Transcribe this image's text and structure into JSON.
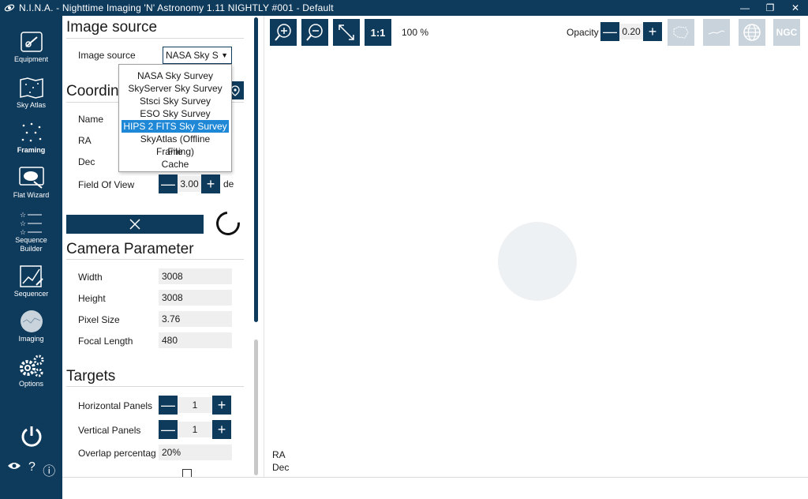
{
  "window": {
    "title": "N.I.N.A. - Nighttime Imaging 'N' Astronomy 1.11 NIGHTLY #001  -  Default",
    "minimize": "—",
    "maximize": "❐",
    "close": "✕"
  },
  "sidebar": {
    "items": [
      {
        "label": "Equipment",
        "icon": "telescope-icon"
      },
      {
        "label": "Sky Atlas",
        "icon": "map-icon"
      },
      {
        "label": "Framing",
        "icon": "stars-icon"
      },
      {
        "label": "Flat Wizard",
        "icon": "flat-wizard-icon"
      },
      {
        "label": "Sequence Builder",
        "icon": "list-stars-icon"
      },
      {
        "label": "Sequencer",
        "icon": "sequencer-icon"
      },
      {
        "label": "Imaging",
        "icon": "imaging-icon"
      },
      {
        "label": "Options",
        "icon": "gears-icon"
      }
    ],
    "active": "Framing",
    "bottom": {
      "power": "⏻",
      "eye": "👁",
      "help": "?",
      "info": "ⓘ"
    }
  },
  "image_source": {
    "title": "Image source",
    "label": "Image source",
    "selected": "NASA Sky S",
    "options": [
      "NASA Sky Survey",
      "SkyServer Sky Survey",
      "Stsci Sky Survey",
      "ESO Sky Survey",
      "HIPS 2 FITS Sky Survey",
      "SkyAtlas (Offline Framing)",
      "File",
      "Cache"
    ],
    "highlighted": "HIPS 2 FITS Sky Survey"
  },
  "coordinates": {
    "title": "Coordin",
    "name_label": "Name",
    "ra_label": "RA",
    "dec_label": "Dec",
    "fov_label": "Field Of View",
    "fov_value": "3.00",
    "fov_unit": "de"
  },
  "camera": {
    "title": "Camera Parameter",
    "width_label": "Width",
    "width_value": "3008",
    "height_label": "Height",
    "height_value": "3008",
    "pixel_label": "Pixel Size",
    "pixel_value": "3.76",
    "focal_label": "Focal Length",
    "focal_value": "480"
  },
  "targets": {
    "title": "Targets",
    "hpanels_label": "Horizontal Panels",
    "hpanels_value": "1",
    "vpanels_label": "Vertical Panels",
    "vpanels_value": "1",
    "overlap_label": "Overlap percentag",
    "overlap_value": "20%"
  },
  "viewer": {
    "zoom_in": "+",
    "zoom_out": "−",
    "fit": "↘",
    "one_to_one": "1:1",
    "zoom_level": "100 %",
    "opacity_label": "Opacity",
    "opacity_value": "0.20",
    "ngc": "NGC",
    "ra_label": "RA",
    "dec_label": "Dec"
  },
  "colors": {
    "accent": "#0e3a5c",
    "highlight": "#1e88d7"
  }
}
